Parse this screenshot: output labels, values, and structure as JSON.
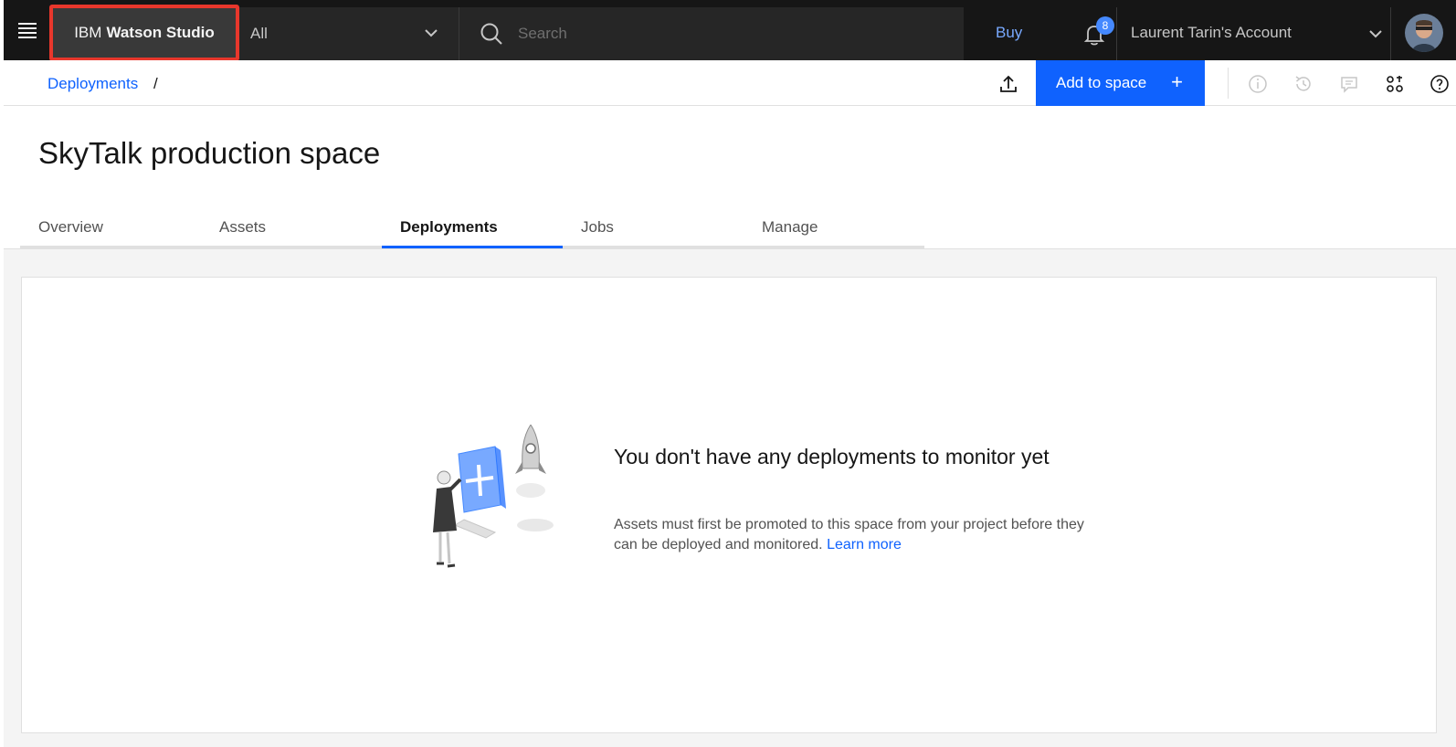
{
  "header": {
    "brand_prefix": "IBM",
    "brand_name": "Watson Studio",
    "scope_selected": "All",
    "search_placeholder": "Search",
    "buy_label": "Buy",
    "notification_count": "8",
    "account_name": "Laurent Tarin's Account"
  },
  "toolbar": {
    "breadcrumb": "Deployments",
    "breadcrumb_sep": "/",
    "add_to_space_label": "Add to space",
    "add_icon": "+"
  },
  "page": {
    "title": "SkyTalk production space",
    "tabs": [
      {
        "label": "Overview",
        "active": false
      },
      {
        "label": "Assets",
        "active": false
      },
      {
        "label": "Deployments",
        "active": true
      },
      {
        "label": "Jobs",
        "active": false
      },
      {
        "label": "Manage",
        "active": false
      }
    ]
  },
  "empty_state": {
    "title": "You don't have any deployments to monitor yet",
    "description": "Assets must first be promoted to this space from your project before they can be deployed and monitored.",
    "link": "Learn more"
  },
  "colors": {
    "highlight_border": "#e8372c",
    "primary_blue": "#0f62fe",
    "header_bg": "#161616"
  },
  "icons": [
    "menu-icon",
    "chevron-down-icon",
    "search-icon",
    "bell-icon",
    "upload-icon",
    "info-icon",
    "history-icon",
    "comment-icon",
    "apps-icon",
    "help-icon"
  ]
}
